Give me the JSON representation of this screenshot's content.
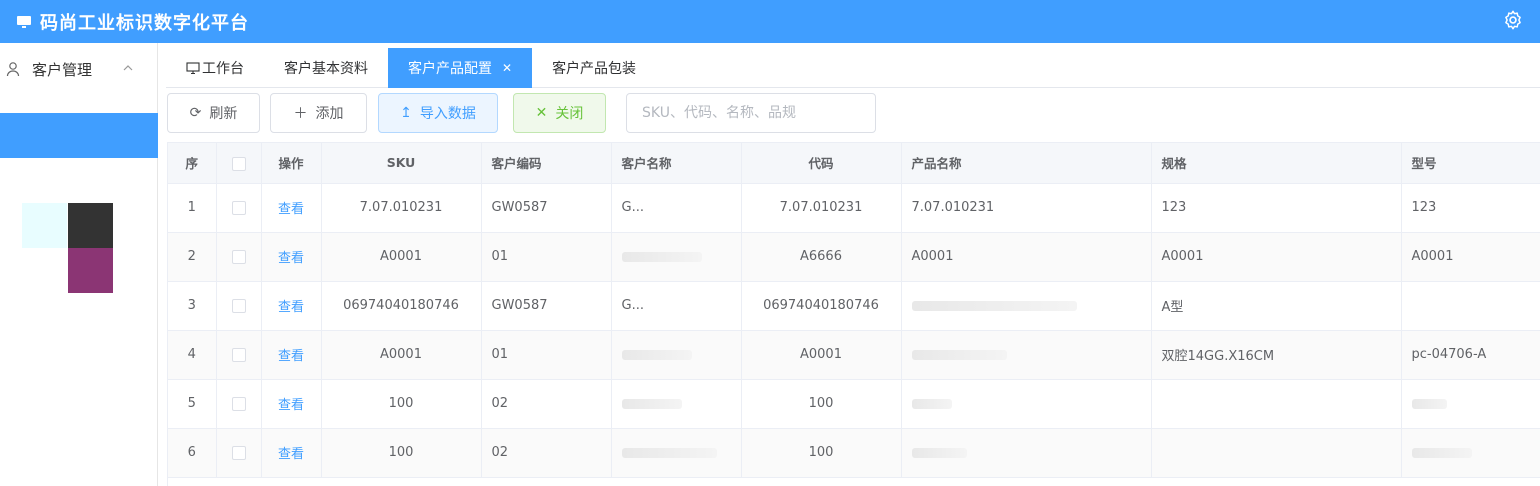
{
  "app": {
    "title": "码尚工业标识数字化平台",
    "accent": "#409eff"
  },
  "sidebar": {
    "menu_label": "客户管理"
  },
  "tabs": [
    {
      "label": "工作台",
      "active": false
    },
    {
      "label": "客户基本资料",
      "active": false
    },
    {
      "label": "客户产品配置",
      "active": true,
      "closable": true
    },
    {
      "label": "客户产品包装",
      "active": false
    }
  ],
  "toolbar": {
    "refresh_label": "刷新",
    "add_label": "添加",
    "import_label": "导入数据",
    "close_label": "关闭",
    "search_placeholder": "SKU、代码、名称、品规"
  },
  "table": {
    "columns": [
      "序",
      "操作",
      "SKU",
      "客户编码",
      "客户名称",
      "代码",
      "产品名称",
      "规格",
      "型号"
    ],
    "action_label": "查看",
    "rows": [
      {
        "idx": "1",
        "sku": "7.07.010231",
        "cust_code": "GW0587",
        "cust_name": "G...",
        "code": "7.07.010231",
        "product": "7.07.010231",
        "spec": "123",
        "model": "123"
      },
      {
        "idx": "2",
        "sku": "A0001",
        "cust_code": "01",
        "cust_name": "",
        "code": "A6666",
        "product": "A0001",
        "spec": "A0001",
        "model": "A0001"
      },
      {
        "idx": "3",
        "sku": "06974040180746",
        "cust_code": "GW0587",
        "cust_name": "G...",
        "code": "06974040180746",
        "product": "",
        "spec": "A型",
        "model": ""
      },
      {
        "idx": "4",
        "sku": "A0001",
        "cust_code": "01",
        "cust_name": "",
        "code": "A0001",
        "product": "",
        "spec": "双腔14GG.X16CM",
        "model": "pc-04706-A"
      },
      {
        "idx": "5",
        "sku": "100",
        "cust_code": "02",
        "cust_name": "",
        "code": "100",
        "product": "",
        "spec": "",
        "model": ""
      },
      {
        "idx": "6",
        "sku": "100",
        "cust_code": "02",
        "cust_name": "",
        "code": "100",
        "product": "",
        "spec": "",
        "model": ""
      }
    ]
  }
}
